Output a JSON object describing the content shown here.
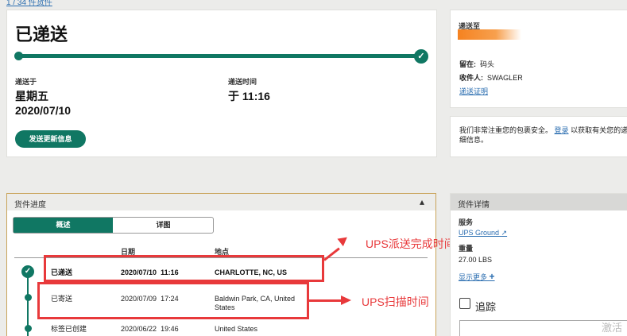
{
  "breadcrumb": {
    "count_text": "1 / 34 件货件"
  },
  "status": {
    "title": "已递送",
    "delivered_on_label": "递送于",
    "delivered_day": "星期五",
    "delivered_date": "2020/07/10",
    "delivery_time_label": "递送时间",
    "delivery_time": "于 11:16",
    "update_button": "发送更新信息"
  },
  "delivered_to": {
    "heading": "递送至",
    "left_at_label": "留在:",
    "left_at_value": "码头",
    "receiver_label": "收件人:",
    "receiver_value": "SWAGLER",
    "proof_link": "递送证明"
  },
  "privacy_note": {
    "text_before": "我们非常注重您的包裹安全。",
    "login_link": "登录",
    "text_after": "以获取有关您的递送",
    "line2": "细信息。"
  },
  "progress_panel": {
    "title": "货件进度",
    "tabs": [
      {
        "label": "概述",
        "active": true
      },
      {
        "label": "详图",
        "active": false
      }
    ],
    "columns": [
      "日期",
      "地点"
    ],
    "rows": [
      {
        "status": "已递送",
        "date": "2020/07/10",
        "time": "11:16",
        "location": "CHARLOTTE, NC, US",
        "location2": ""
      },
      {
        "status": "已寄送",
        "date": "2020/07/09",
        "time": "17:24",
        "location": "Baldwin Park, CA, United",
        "location2": "States"
      },
      {
        "status": "标签已创建",
        "date": "2020/06/22",
        "time": "19:46",
        "location": "United States",
        "location2": ""
      }
    ]
  },
  "annotations": {
    "delivery_time": "UPS派送完成时间",
    "scan_time": "UPS扫描时间"
  },
  "details_panel": {
    "title": "货件详情",
    "service_label": "服务",
    "service_value": "UPS Ground",
    "weight_label": "重量",
    "weight_value": "27.00 LBS",
    "show_more": "显示更多",
    "track_title": "追踪"
  },
  "watermark": "激活",
  "colors": {
    "brand_green": "#107763",
    "accent_orange": "#f58220",
    "annotation_red": "#e8393b"
  }
}
